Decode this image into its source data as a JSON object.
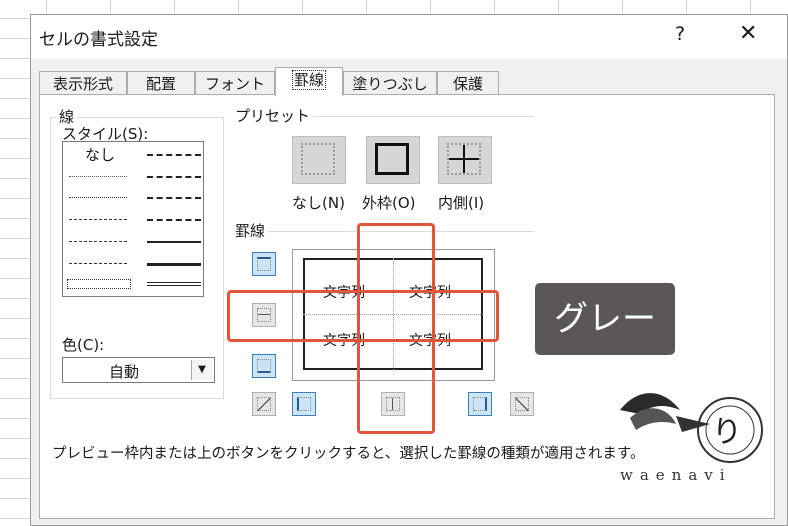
{
  "dialog": {
    "title": "セルの書式設定",
    "help": "?",
    "close": "✕",
    "tabs": [
      "表示形式",
      "配置",
      "フォント",
      "罫線",
      "塗りつぶし",
      "保護"
    ],
    "active_tab": "罫線"
  },
  "line": {
    "group_label": "線",
    "style_label": "スタイル(S):",
    "none_label": "なし",
    "color_label": "色(C):",
    "color_value": "自動"
  },
  "presets": {
    "group_label": "プリセット",
    "none": "なし(N)",
    "outline": "外枠(O)",
    "inside": "内側(I)"
  },
  "border": {
    "group_label": "罫線",
    "cell_text": "文字列"
  },
  "annotation": {
    "gray_label": "グレー",
    "highlight_color": "#e2553d"
  },
  "footer": "プレビュー枠内または上のボタンをクリックすると、選択した罫線の種類が適用されます。",
  "logo": {
    "wordmark": "waenavi"
  }
}
